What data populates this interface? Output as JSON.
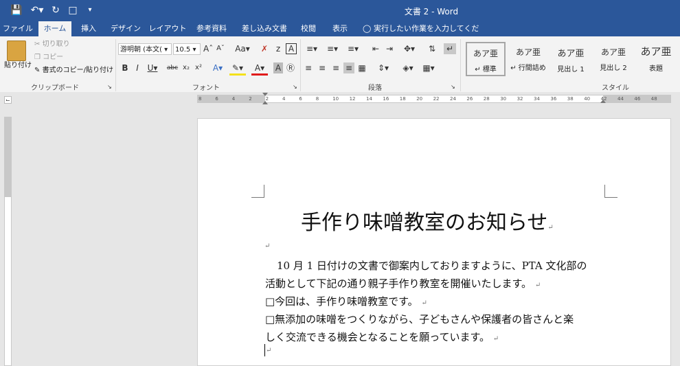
{
  "titlebar": {
    "title": "文書 2 - Word",
    "quick_access": [
      "save-icon",
      "undo-icon",
      "redo-icon",
      "new-icon",
      "customize-icon"
    ]
  },
  "tabs": [
    "ファイル",
    "ホーム",
    "挿入",
    "デザイン",
    "レイアウト",
    "参考資料",
    "差し込み文書",
    "校閲",
    "表示"
  ],
  "tell_me": "実行したい作業を入力してください...",
  "clipboard": {
    "paste": "貼り付け",
    "cut": "切り取り",
    "copy": "コピー",
    "format_painter": "書式のコピー/貼り付け",
    "label": "クリップボード"
  },
  "font": {
    "name": "游明朝 (本文(",
    "size": "10.5",
    "label": "フォント"
  },
  "paragraph": {
    "label": "段落"
  },
  "styles": {
    "label": "スタイル",
    "items": [
      {
        "sample": "あア亜",
        "name": "↵ 標準"
      },
      {
        "sample": "あア亜",
        "name": "↵ 行間詰め"
      },
      {
        "sample": "あア亜",
        "name": "見出し 1"
      },
      {
        "sample": "あア亜",
        "name": "見出し 2"
      },
      {
        "sample": "あア亜",
        "name": "表題"
      }
    ]
  },
  "ruler": {
    "h_ticks": [
      "8",
      "6",
      "4",
      "2",
      "2",
      "4",
      "6",
      "8",
      "10",
      "12",
      "14",
      "16",
      "18",
      "20",
      "22",
      "24",
      "26",
      "28",
      "30",
      "32",
      "34",
      "36",
      "38",
      "40",
      "42",
      "44",
      "46",
      "48"
    ]
  },
  "document": {
    "title": "手作り味噌教室のお知らせ",
    "para1_line1": "10 月 1 日付けの文書で御案内しておりますように、PTA 文化部の",
    "para1_line2": "活動として下記の通り親子手作り教室を開催いたします。",
    "para2": "□今回は、手作り味噌教室です。",
    "para3_line1": "□無添加の味噌をつくりながら、子どもさんや保護者の皆さんと楽",
    "para3_line2": "しく交流できる機会となることを願っています。",
    "paragraph_mark": "↵"
  }
}
